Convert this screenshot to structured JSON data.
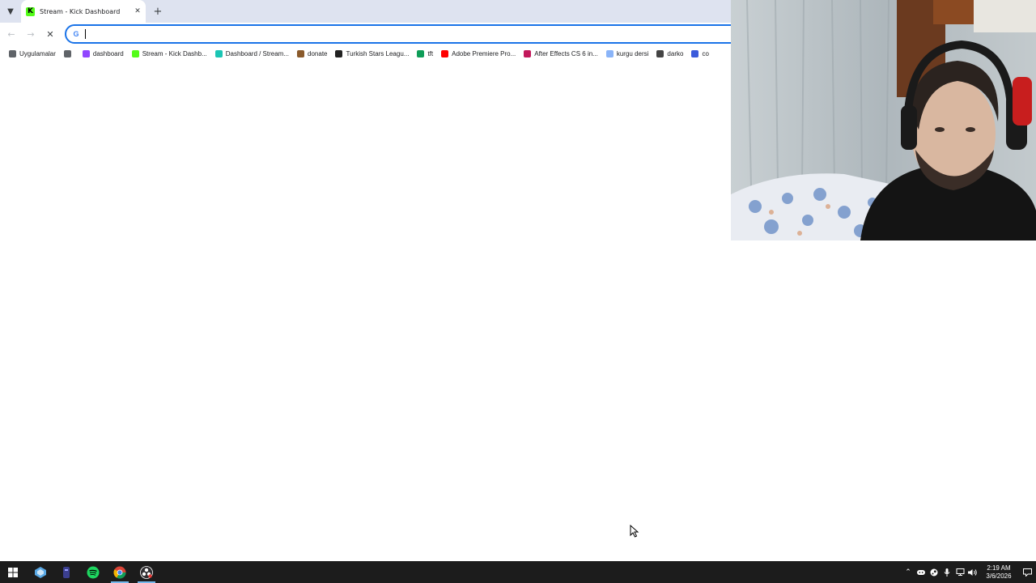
{
  "browser": {
    "tab": {
      "title": "Stream - Kick Dashboard",
      "favicon_letter": "K",
      "favicon_color": "#53fc18"
    },
    "omnibox": {
      "value": "",
      "placeholder": ""
    },
    "bookmarks": [
      {
        "label": "Uygulamalar",
        "icon": "apps-grid-icon",
        "color": "#5f6368"
      },
      {
        "label": "",
        "icon": "grid-icon",
        "color": "#5f6368"
      },
      {
        "label": "dashboard",
        "icon": "twitch-icon",
        "color": "#9146ff"
      },
      {
        "label": "Stream - Kick Dashb...",
        "icon": "kick-icon",
        "color": "#53fc18"
      },
      {
        "label": "Dashboard / Stream...",
        "icon": "streamelements-icon",
        "color": "#1bc5b4"
      },
      {
        "label": "donate",
        "icon": "donate-icon",
        "color": "#8a5a2b"
      },
      {
        "label": "Turkish Stars Leagu...",
        "icon": "tsl-icon",
        "color": "#222222"
      },
      {
        "label": "tft",
        "icon": "sheets-icon",
        "color": "#0f9d58"
      },
      {
        "label": "Adobe Premiere Pro...",
        "icon": "youtube-icon",
        "color": "#ff0000"
      },
      {
        "label": "After Effects CS 6 in...",
        "icon": "ae-icon",
        "color": "#c2185b"
      },
      {
        "label": "kurgu dersi",
        "icon": "globe-icon",
        "color": "#8ab4f8"
      },
      {
        "label": "darko",
        "icon": "darko-icon",
        "color": "#444444"
      },
      {
        "label": "co",
        "icon": "co-icon",
        "color": "#3b5bdb"
      }
    ]
  },
  "taskbar": {
    "apps": [
      "windows-start-icon",
      "app-icon-1",
      "app-icon-2",
      "spotify-icon",
      "chrome-icon",
      "obs-icon"
    ],
    "clock_time": "2:19 AM",
    "clock_date": "3/6/2026"
  },
  "colors": {
    "accent": "#1a73e8",
    "tabstrip": "#dee3f0",
    "taskbar": "#1c1c1c"
  }
}
